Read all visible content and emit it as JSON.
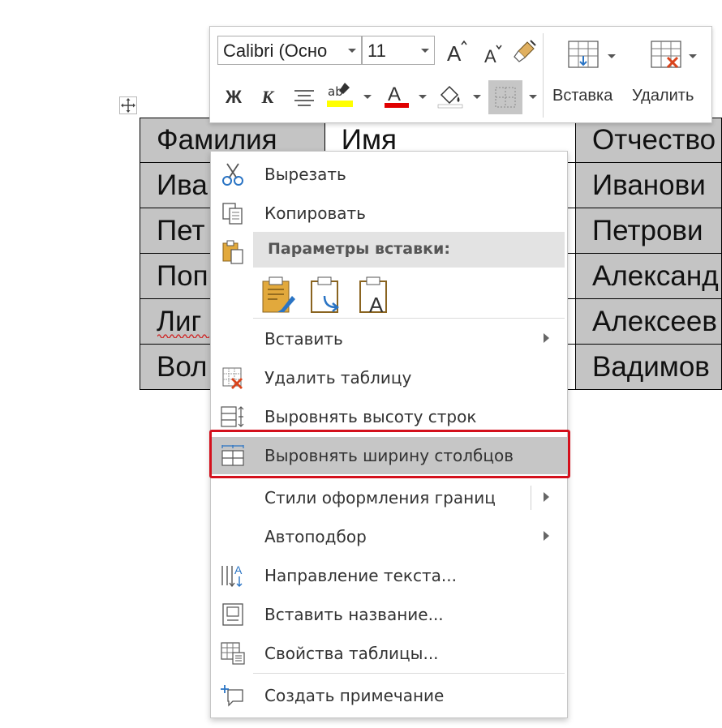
{
  "table": {
    "rows": [
      [
        "Фамилия",
        "Имя",
        "Отчество"
      ],
      [
        "Ива",
        "",
        "Иванови"
      ],
      [
        "Пет",
        "",
        "Петрови"
      ],
      [
        "Поп",
        "",
        "Александ"
      ],
      [
        "Лиг",
        "",
        "Алексеев"
      ],
      [
        "Вол",
        "",
        "Вадимов"
      ]
    ]
  },
  "toolbar": {
    "font_name": "Calibri (Осно",
    "font_size": "11",
    "bold_label": "Ж",
    "italic_label": "К",
    "insert_label": "Вставка",
    "delete_label": "Удалить",
    "highlight_color": "#ffff00",
    "font_color": "#e00000"
  },
  "context_menu": {
    "cut": "Вырезать",
    "copy": "Копировать",
    "paste_options_header": "Параметры вставки:",
    "insert": "Вставить",
    "delete_table": "Удалить таблицу",
    "distribute_rows": "Выровнять высоту строк",
    "distribute_columns": "Выровнять ширину столбцов",
    "border_styles": "Стили оформления границ",
    "autofit": "Автоподбор",
    "text_direction": "Направление текста...",
    "insert_caption": "Вставить название...",
    "table_properties": "Свойства таблицы...",
    "new_comment": "Создать примечание"
  },
  "colors": {
    "highlight_frame": "#d4101c",
    "selected_cell": "#c4c4c4"
  }
}
